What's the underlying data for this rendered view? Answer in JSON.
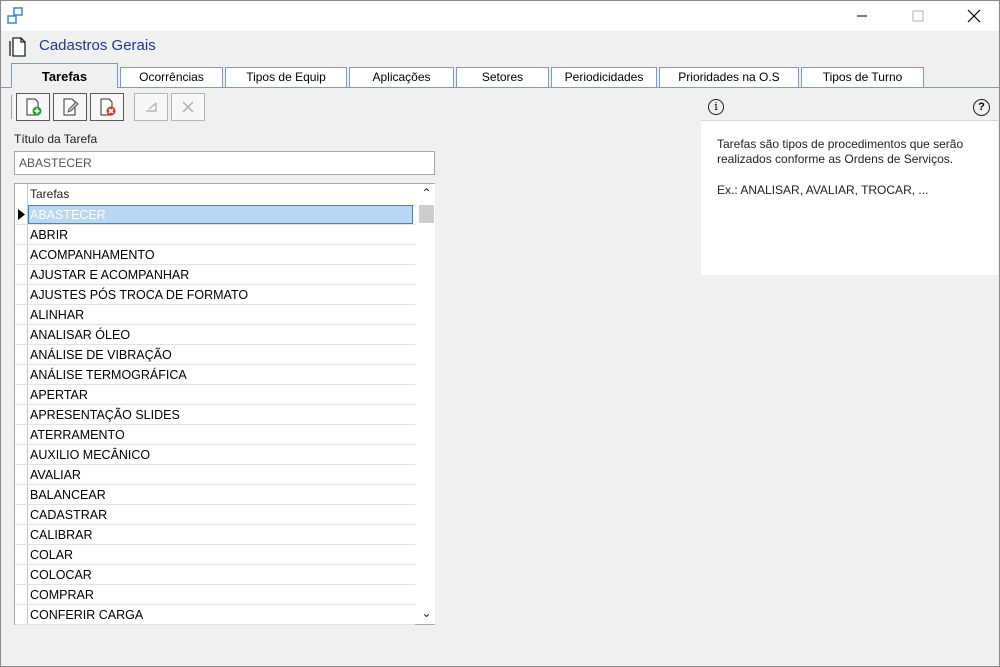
{
  "header": {
    "title": "Cadastros Gerais"
  },
  "tabs": [
    {
      "label": "Tarefas",
      "active": true
    },
    {
      "label": "Ocorrências"
    },
    {
      "label": "Tipos de Equip"
    },
    {
      "label": "Aplicações"
    },
    {
      "label": "Setores"
    },
    {
      "label": "Periodicidades"
    },
    {
      "label": "Prioridades na O.S"
    },
    {
      "label": "Tipos de Turno"
    }
  ],
  "toolbar": {
    "buttons": [
      {
        "name": "new-icon",
        "enabled": true
      },
      {
        "name": "edit-icon",
        "enabled": true
      },
      {
        "name": "delete-icon",
        "enabled": true
      },
      {
        "name": "save-icon",
        "enabled": false
      },
      {
        "name": "cancel-icon",
        "enabled": false
      }
    ]
  },
  "form": {
    "title_label": "Título da Tarefa",
    "title_value": "ABASTECER"
  },
  "grid": {
    "column_header": "Tarefas",
    "rows": [
      "ABASTECER",
      "ABRIR",
      "ACOMPANHAMENTO",
      "AJUSTAR E ACOMPANHAR",
      "AJUSTES PÓS TROCA DE FORMATO",
      "ALINHAR",
      "ANALISAR ÓLEO",
      "ANÁLISE DE VIBRAÇÃO",
      "ANÁLISE TERMOGRÁFICA",
      "APERTAR",
      "APRESENTAÇÃO SLIDES",
      "ATERRAMENTO",
      "AUXILIO MECÂNICO",
      "AVALIAR",
      "BALANCEAR",
      "CADASTRAR",
      "CALIBRAR",
      "COLAR",
      "COLOCAR",
      "COMPRAR",
      "CONFERIR CARGA"
    ],
    "selected_index": 0
  },
  "help": {
    "info_glyph": "i",
    "help_glyph": "?",
    "text": "Tarefas são tipos de procedimentos que serão realizados conforme as Ordens de Serviços.",
    "example": "Ex.: ANALISAR, AVALIAR, TROCAR, ..."
  },
  "colors": {
    "accent": "#1f3a8a",
    "tab_border": "#7a9bd1",
    "selection": "#b9d6f3",
    "selection_border": "#3a86d6"
  }
}
